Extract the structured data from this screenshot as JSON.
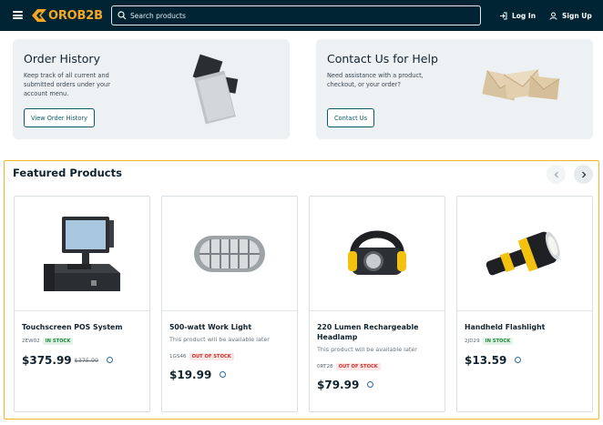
{
  "header": {
    "logo_text": "OROB2B",
    "search_placeholder": "Search products",
    "login_label": "Log In",
    "signup_label": "Sign Up",
    "bg_color": "#002434",
    "accent_color": "#f5a623"
  },
  "promos": [
    {
      "title": "Order History",
      "text": "Keep track of all current and submitted orders under your account menu.",
      "button": "View Order History"
    },
    {
      "title": "Contact Us for Help",
      "text": "Need assistance with a product, checkout, or your order?",
      "button": "Contact Us"
    }
  ],
  "featured": {
    "title": "Featured Products",
    "products": [
      {
        "name": "Touchscreen POS System",
        "sku": "2EW02",
        "stock": "IN STOCK",
        "price": "$375.99",
        "old_price": "$375.99",
        "note": ""
      },
      {
        "name": "500-watt Work Light",
        "sku": "1GS46",
        "stock": "OUT OF STOCK",
        "price": "$19.99",
        "note": "This product will be available later"
      },
      {
        "name": "220 Lumen Rechargeable Headlamp",
        "sku": "0RT28",
        "stock": "OUT OF STOCK",
        "price": "$79.99",
        "note": "This product will be available later"
      },
      {
        "name": "Handheld Flashlight",
        "sku": "2JD29",
        "stock": "IN STOCK",
        "price": "$13.59",
        "note": ""
      }
    ]
  }
}
